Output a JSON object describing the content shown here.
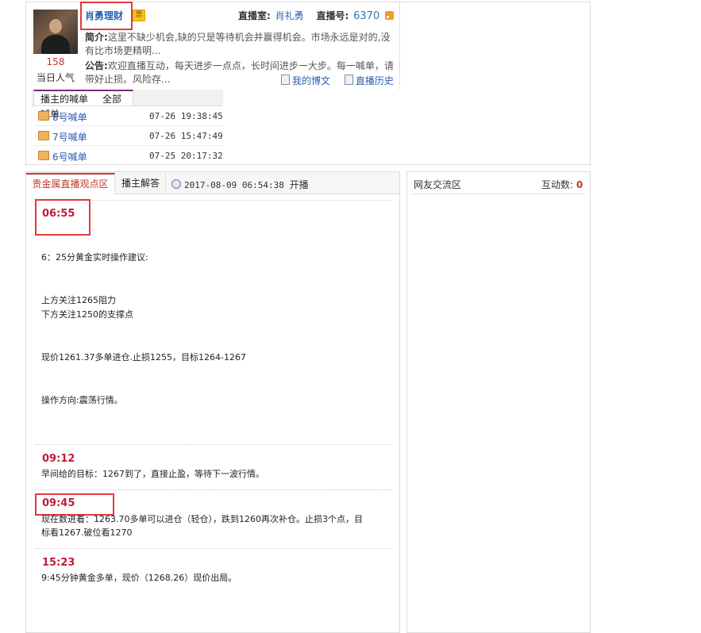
{
  "host": {
    "name": "肖勇理财",
    "badge": "票",
    "room_label": "直播室:",
    "room_name": "肖礼勇",
    "room_no_label": "直播号:",
    "room_no": "6370",
    "popularity": "158",
    "popularity_label": "当日人气",
    "intro_label": "简介:",
    "intro_text": "这里不缺少机会,缺的只是等待机会并赢得机会。市场永远是对的,没有比市场更精明...",
    "notice_label": "公告:",
    "notice_text": "欢迎直播互动，每天进步一点点，长时间进步一大步。每一喊单，请带好止损。风险存...",
    "link_blog": "我的博文",
    "link_history": "直播历史"
  },
  "calls": {
    "tab_active": "播主的喊单",
    "tab_all": "全部",
    "header_fragment": "喊单",
    "items": [
      {
        "label": "8号喊单",
        "time": "07-26 19:38:45"
      },
      {
        "label": "7号喊单",
        "time": "07-26 15:47:49"
      },
      {
        "label": "6号喊单",
        "time": "07-25 20:17:32"
      }
    ]
  },
  "tabs": {
    "t1": "贵金属直播观点区",
    "t2": "播主解答",
    "start_time": "2017-08-09 06:54:38",
    "start_label": "开播"
  },
  "posts": [
    {
      "time": "06:55",
      "lines": [
        "6：25分黄金实时操作建议:",
        "上方关注1265阻力",
        "下方关注1250的支撑点",
        "现价1261.37多单进仓.止损1255，目标1264-1267",
        "操作方向:震荡行情。"
      ]
    },
    {
      "time": "09:12",
      "lines": [
        "早间给的目标：1267到了，直接止盈，等待下一波行情。"
      ]
    },
    {
      "time": "09:45",
      "lines": [
        "现在数进着：1263.70多单可以进仓（轻仓），跌到1260再次补仓。止损3个点，目",
        "标看1267.破位看1270"
      ]
    },
    {
      "time": "15:23",
      "lines": [
        "9:45分钟黄金多单，现价（1268.26）现价出局。"
      ]
    }
  ],
  "sidebar": {
    "title": "网友交流区",
    "count_label": "互动数:",
    "count": "0"
  }
}
